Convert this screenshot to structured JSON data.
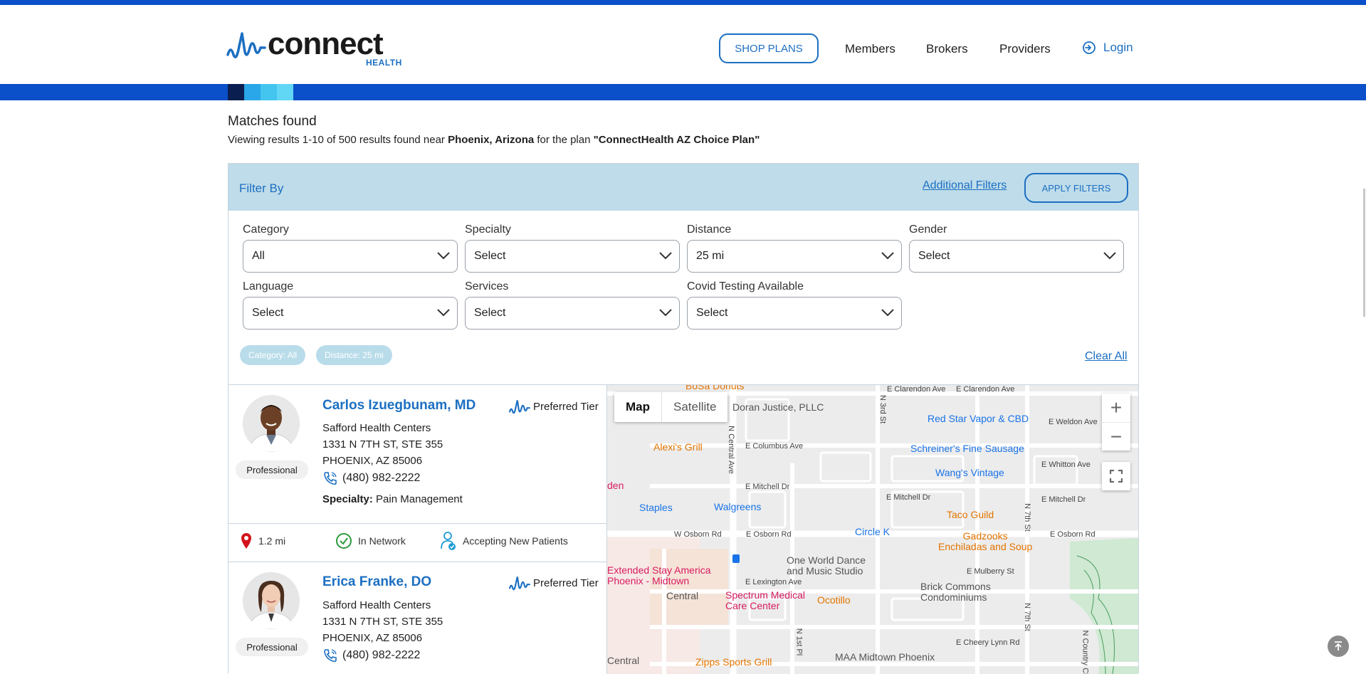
{
  "header": {
    "logo_word": "connect",
    "logo_sub": "HEALTH",
    "shop_plans": "SHOP PLANS",
    "nav": [
      "Members",
      "Brokers",
      "Providers"
    ],
    "login": "Login"
  },
  "results": {
    "title": "Matches found",
    "sub_prefix": "Viewing results 1-10 of 500 results found near ",
    "location": "Phoenix, Arizona",
    "sub_mid": " for the plan ",
    "plan": "\"ConnectHealth AZ Choice Plan\""
  },
  "filters": {
    "title": "Filter By",
    "additional": "Additional Filters",
    "apply": "APPLY FILTERS",
    "clear_all": "Clear All",
    "fields": [
      {
        "label": "Category",
        "value": "All"
      },
      {
        "label": "Specialty",
        "value": "Select"
      },
      {
        "label": "Distance",
        "value": "25 mi"
      },
      {
        "label": "Gender",
        "value": "Select"
      },
      {
        "label": "Language",
        "value": "Select"
      },
      {
        "label": "Services",
        "value": "Select"
      },
      {
        "label": "Covid Testing Available",
        "value": "Select"
      }
    ],
    "chips": [
      "Category: All",
      "Distance: 25 mi"
    ]
  },
  "providers": [
    {
      "name": "Carlos Izuegbunam, MD",
      "tier": "Preferred Tier",
      "type": "Professional",
      "org": "Safford Health Centers",
      "addr1": "1331 N 7TH ST, STE 355",
      "addr2": "PHOENIX, AZ 85006",
      "phone": "(480) 982-2222",
      "specialty_label": "Specialty:",
      "specialty": "Pain Management",
      "distance": "1.2 mi",
      "network": "In Network",
      "accepting": "Accepting New Patients"
    },
    {
      "name": "Erica Franke, DO",
      "tier": "Preferred Tier",
      "type": "Professional",
      "org": "Safford Health Centers",
      "addr1": "1331 N 7TH ST, STE 355",
      "addr2": "PHOENIX, AZ 85006",
      "phone": "(480) 982-2222"
    }
  ],
  "map": {
    "tabs": [
      "Map",
      "Satellite"
    ],
    "zoom_in": "+",
    "zoom_out": "−",
    "pois": {
      "bosa": "BoSa Donuts",
      "doran": "Doran Justice, PLLC",
      "red_star": "Red Star Vapor & CBD",
      "alexis": "Alexi's Grill",
      "schreiner": "Schreiner's Fine Sausage",
      "wangs": "Wang's Vintage",
      "den": "den",
      "staples": "Staples",
      "walgreens": "Walgreens",
      "taco_guild": "Taco Guild",
      "circle_k": "Circle K",
      "gadzooks": "Gadzooks\nEnchiladas and Soup",
      "extended_stay": "Extended Stay America\nPhoenix - Midtown",
      "one_world": "One World Dance\nand Music Studio",
      "central": "Central",
      "spectrum": "Spectrum Medical\nCare Center",
      "ocotillo": "Ocotillo",
      "brick": "Brick Commons\nCondominiums",
      "central2": "Central",
      "zipps": "Zipps Sports Grill",
      "maa": "MAA Midtown Phoenix"
    },
    "streets": {
      "clarendon1": "E Clarendon Ave",
      "clarendon2": "E Clarendon Ave",
      "weldon": "E Weldon Ave",
      "columbus": "E Columbus Ave",
      "whitton": "E Whitton Ave",
      "mitchell1": "E Mitchell Dr",
      "mitchell2": "E Mitchell Dr",
      "mitchell3": "E Mitchell Dr",
      "w_osborn": "W Osborn Rd",
      "e_osborn1": "E Osborn Rd",
      "e_osborn2": "E Osborn Rd",
      "mulberry": "E Mulberry St",
      "lexington": "E Lexington Ave",
      "cheery": "E Cheery Lynn Rd",
      "central_ave": "N Central Ave",
      "n3rd": "N 3rd St",
      "n7th1": "N 7th St",
      "n7th2": "N 7th St",
      "n1st": "N 1st Pl",
      "country": "N Country Cl"
    }
  },
  "colors": {
    "brand_blue": "#1c6fc2",
    "band_blue": "#0b50c9",
    "filter_bg": "#bfdcea"
  }
}
